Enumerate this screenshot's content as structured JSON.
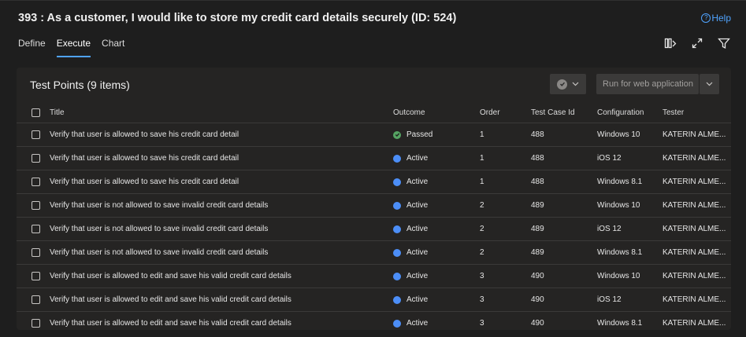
{
  "header": {
    "title": "393 : As a customer, I would like to store my credit card details securely (ID: 524)",
    "help_label": "Help",
    "help_icon": "help-circle-icon"
  },
  "tabs": [
    {
      "label": "Define",
      "active": false
    },
    {
      "label": "Execute",
      "active": true
    },
    {
      "label": "Chart",
      "active": false
    }
  ],
  "toolbar": {
    "icons": [
      "column-options-icon",
      "expand-icon",
      "filter-icon"
    ]
  },
  "panel": {
    "title": "Test Points (9 items)",
    "outcome_button_icon": "check-circle-icon",
    "run_button_label": "Run for web application"
  },
  "columns": {
    "title": "Title",
    "outcome": "Outcome",
    "order": "Order",
    "test_case_id": "Test Case Id",
    "configuration": "Configuration",
    "tester": "Tester"
  },
  "rows": [
    {
      "title": "Verify that user is allowed to save his credit card detail",
      "outcome": "Passed",
      "order": "1",
      "test_case_id": "488",
      "configuration": "Windows 10",
      "tester": "KATERIN ALME..."
    },
    {
      "title": "Verify that user is allowed to save his credit card detail",
      "outcome": "Active",
      "order": "1",
      "test_case_id": "488",
      "configuration": "iOS 12",
      "tester": "KATERIN ALME..."
    },
    {
      "title": "Verify that user is allowed to save his credit card detail",
      "outcome": "Active",
      "order": "1",
      "test_case_id": "488",
      "configuration": "Windows 8.1",
      "tester": "KATERIN ALME..."
    },
    {
      "title": "Verify that user is not allowed to save invalid credit card details",
      "outcome": "Active",
      "order": "2",
      "test_case_id": "489",
      "configuration": "Windows 10",
      "tester": "KATERIN ALME..."
    },
    {
      "title": "Verify that user is not allowed to save invalid credit card details",
      "outcome": "Active",
      "order": "2",
      "test_case_id": "489",
      "configuration": "iOS 12",
      "tester": "KATERIN ALME..."
    },
    {
      "title": "Verify that user is not allowed to save invalid credit card details",
      "outcome": "Active",
      "order": "2",
      "test_case_id": "489",
      "configuration": "Windows 8.1",
      "tester": "KATERIN ALME..."
    },
    {
      "title": "Verify that user is allowed to edit and save his valid credit card details",
      "outcome": "Active",
      "order": "3",
      "test_case_id": "490",
      "configuration": "Windows 10",
      "tester": "KATERIN ALME..."
    },
    {
      "title": "Verify that user is allowed to edit and save his valid credit card details",
      "outcome": "Active",
      "order": "3",
      "test_case_id": "490",
      "configuration": "iOS 12",
      "tester": "KATERIN ALME..."
    },
    {
      "title": "Verify that user is allowed to edit and save his valid credit card details",
      "outcome": "Active",
      "order": "3",
      "test_case_id": "490",
      "configuration": "Windows 8.1",
      "tester": "KATERIN ALME..."
    }
  ],
  "colors": {
    "accent": "#4fa3ff",
    "passed": "#55a362",
    "active": "#4c8ef7"
  }
}
